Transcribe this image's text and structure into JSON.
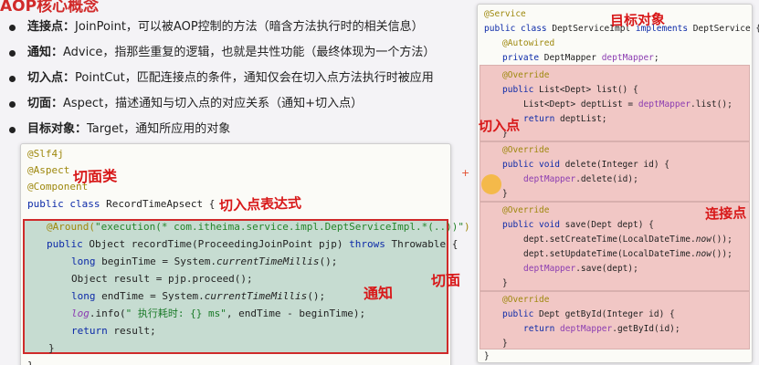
{
  "heading": "AOP核心概念",
  "definitions": [
    {
      "term": "连接点：",
      "text": "JoinPoint，可以被AOP控制的方法（暗含方法执行时的相关信息）"
    },
    {
      "term": "通知：",
      "text": "Advice，指那些重复的逻辑，也就是共性功能（最终体现为一个方法）"
    },
    {
      "term": "切入点：",
      "text": "PointCut，匹配连接点的条件，通知仅会在切入点方法执行时被应用"
    },
    {
      "term": "切面：",
      "text": "Aspect，描述通知与切入点的对应关系（通知+切入点）"
    },
    {
      "term": "目标对象：",
      "text": "Target，通知所应用的对象"
    }
  ],
  "left_code": {
    "l1": "@Slf4j",
    "l2": "@Aspect",
    "l3": "@Component",
    "l4_kw": "public class",
    "l4_rest": " RecordTimeApsect {",
    "l5_anno": "@Around(",
    "l5_str": "\"execution(* com.itheima.service.impl.DeptServiceImpl.*(..))\"",
    "l5_end": ")",
    "l6_kw": "public",
    "l6_a": " Object recordTime(ProceedingJoinPoint pjp) ",
    "l6_kw2": "throws",
    "l6_b": " Throwable {",
    "l7_kw": "long",
    "l7_a": " beginTime = System.",
    "l7_it": "currentTimeMillis",
    "l7_b": "();",
    "l8": "Object result = pjp.proceed();",
    "l9_kw": "long",
    "l9_a": " endTime = System.",
    "l9_it": "currentTimeMillis",
    "l9_b": "();",
    "l10_log": "log",
    "l10_a": ".info(",
    "l10_str": "\" 执行耗时: {} ms\"",
    "l10_b": ", endTime - beginTime);",
    "l11_kw": "return",
    "l11_a": " result;",
    "l12": "}",
    "l13": "}"
  },
  "right_code": {
    "r1": "@Service",
    "r2_kw": "public class",
    "r2_a": " DeptServiceImpl ",
    "r2_kw2": "implements",
    "r2_b": " DeptService {",
    "r3": "@Autowired",
    "r4_kw": "private",
    "r4_a": " DeptMapper ",
    "r4_f": "deptMapper",
    "r4_b": ";",
    "r5": "@Override",
    "r6_kw": "public",
    "r6_a": " List<Dept> list() {",
    "r7_a": "List<Dept> deptList = ",
    "r7_f": "deptMapper",
    "r7_b": ".list();",
    "r8_kw": "return",
    "r8_a": " deptList;",
    "r9": "}",
    "r10": "@Override",
    "r11_kw": "public void",
    "r11_a": " delete(Integer id) {",
    "r12_f": "deptMapper",
    "r12_a": ".delete(id);",
    "r13": "}",
    "r14": "@Override",
    "r15_kw": "public void",
    "r15_a": " save(Dept dept) {",
    "r16_a": "dept.setCreateTime(LocalDateTime.",
    "r16_it": "now",
    "r16_b": "());",
    "r17_a": "dept.setUpdateTime(LocalDateTime.",
    "r17_it": "now",
    "r17_b": "());",
    "r18_f": "deptMapper",
    "r18_a": ".save(dept);",
    "r19": "}",
    "r20": "@Override",
    "r21_kw": "public",
    "r21_a": " Dept getById(Integer id) {",
    "r22_kw": "return",
    "r22_f": " deptMapper",
    "r22_a": ".getById(id);",
    "r23": "}",
    "r24": "}"
  },
  "handwritten": {
    "aspect_class": "切面类",
    "pointcut_expr": "切入点表达式",
    "advice": "通知",
    "aspect": "切面",
    "target": "目标对象",
    "pointcut": "切入点",
    "joinpoint": "连接点"
  }
}
